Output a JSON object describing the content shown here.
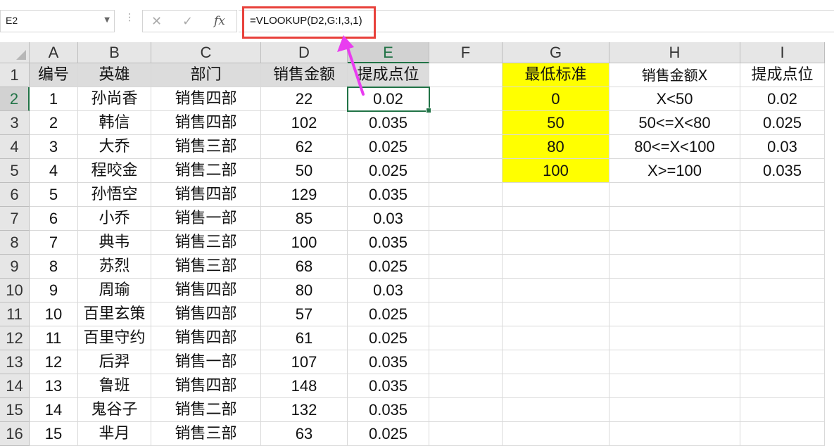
{
  "name_box": {
    "value": "E2"
  },
  "formula_bar": {
    "cancel_symbol": "✕",
    "enter_symbol": "✓",
    "fx_label": "fx",
    "formula": "=VLOOKUP(D2,G:I,3,1)"
  },
  "columns": [
    "A",
    "B",
    "C",
    "D",
    "E",
    "F",
    "G",
    "H",
    "I"
  ],
  "selected_cell": "E2",
  "annotation": {
    "highlight_color": "#e8413b",
    "arrow_color": "#e93cf0"
  },
  "highlight_color": "#ffff00",
  "rows": [
    {
      "n": "1",
      "A": "编号",
      "B": "英雄",
      "C": "部门",
      "D": "销售金额",
      "E": "提成点位",
      "F": "",
      "G": "最低标准",
      "H": "销售金额X",
      "I": "提成点位"
    },
    {
      "n": "2",
      "A": "1",
      "B": "孙尚香",
      "C": "销售四部",
      "D": "22",
      "E": "0.02",
      "F": "",
      "G": "0",
      "H": "X<50",
      "I": "0.02"
    },
    {
      "n": "3",
      "A": "2",
      "B": "韩信",
      "C": "销售四部",
      "D": "102",
      "E": "0.035",
      "F": "",
      "G": "50",
      "H": "50<=X<80",
      "I": "0.025"
    },
    {
      "n": "4",
      "A": "3",
      "B": "大乔",
      "C": "销售三部",
      "D": "62",
      "E": "0.025",
      "F": "",
      "G": "80",
      "H": "80<=X<100",
      "I": "0.03"
    },
    {
      "n": "5",
      "A": "4",
      "B": "程咬金",
      "C": "销售二部",
      "D": "50",
      "E": "0.025",
      "F": "",
      "G": "100",
      "H": "X>=100",
      "I": "0.035"
    },
    {
      "n": "6",
      "A": "5",
      "B": "孙悟空",
      "C": "销售四部",
      "D": "129",
      "E": "0.035",
      "F": "",
      "G": "",
      "H": "",
      "I": ""
    },
    {
      "n": "7",
      "A": "6",
      "B": "小乔",
      "C": "销售一部",
      "D": "85",
      "E": "0.03",
      "F": "",
      "G": "",
      "H": "",
      "I": ""
    },
    {
      "n": "8",
      "A": "7",
      "B": "典韦",
      "C": "销售三部",
      "D": "100",
      "E": "0.035",
      "F": "",
      "G": "",
      "H": "",
      "I": ""
    },
    {
      "n": "9",
      "A": "8",
      "B": "苏烈",
      "C": "销售三部",
      "D": "68",
      "E": "0.025",
      "F": "",
      "G": "",
      "H": "",
      "I": ""
    },
    {
      "n": "10",
      "A": "9",
      "B": "周瑜",
      "C": "销售四部",
      "D": "80",
      "E": "0.03",
      "F": "",
      "G": "",
      "H": "",
      "I": ""
    },
    {
      "n": "11",
      "A": "10",
      "B": "百里玄策",
      "C": "销售四部",
      "D": "57",
      "E": "0.025",
      "F": "",
      "G": "",
      "H": "",
      "I": ""
    },
    {
      "n": "12",
      "A": "11",
      "B": "百里守约",
      "C": "销售四部",
      "D": "61",
      "E": "0.025",
      "F": "",
      "G": "",
      "H": "",
      "I": ""
    },
    {
      "n": "13",
      "A": "12",
      "B": "后羿",
      "C": "销售一部",
      "D": "107",
      "E": "0.035",
      "F": "",
      "G": "",
      "H": "",
      "I": ""
    },
    {
      "n": "14",
      "A": "13",
      "B": "鲁班",
      "C": "销售四部",
      "D": "148",
      "E": "0.035",
      "F": "",
      "G": "",
      "H": "",
      "I": ""
    },
    {
      "n": "15",
      "A": "14",
      "B": "鬼谷子",
      "C": "销售二部",
      "D": "132",
      "E": "0.035",
      "F": "",
      "G": "",
      "H": "",
      "I": ""
    },
    {
      "n": "16",
      "A": "15",
      "B": "芈月",
      "C": "销售三部",
      "D": "63",
      "E": "0.025",
      "F": "",
      "G": "",
      "H": "",
      "I": ""
    }
  ]
}
